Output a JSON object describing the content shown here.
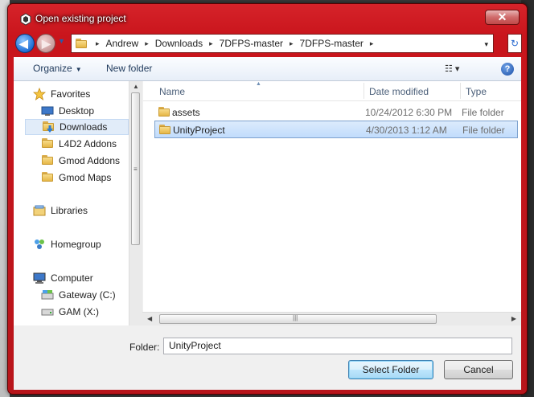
{
  "window": {
    "title": "Open existing project",
    "close_label": "✕"
  },
  "address": {
    "crumbs": [
      "Andrew",
      "Downloads",
      "7DFPS-master",
      "7DFPS-master"
    ],
    "separator": "▸",
    "dropdown_glyph": "▾",
    "refresh_glyph": "↻"
  },
  "toolbar": {
    "organize_label": "Organize",
    "new_folder_label": "New folder",
    "view_glyph": "☷ ▾",
    "help_glyph": "?"
  },
  "nav": {
    "items": [
      {
        "label": "Favorites",
        "icon": "star-icon"
      },
      {
        "label": "Desktop",
        "icon": "desktop-icon"
      },
      {
        "label": "Downloads",
        "icon": "downloads-icon",
        "selected": true
      },
      {
        "label": "L4D2 Addons",
        "icon": "folder-icon"
      },
      {
        "label": "Gmod Addons",
        "icon": "folder-icon"
      },
      {
        "label": "Gmod Maps",
        "icon": "folder-icon"
      },
      {
        "label": "Libraries",
        "icon": "libraries-icon"
      },
      {
        "label": "Homegroup",
        "icon": "homegroup-icon"
      },
      {
        "label": "Computer",
        "icon": "computer-icon"
      },
      {
        "label": "Gateway (C:)",
        "icon": "drive-icon"
      },
      {
        "label": "GAM (X:)",
        "icon": "drive-icon"
      }
    ]
  },
  "columns": {
    "name": "Name",
    "date": "Date modified",
    "type": "Type"
  },
  "files": [
    {
      "name": "assets",
      "date": "10/24/2012 6:30 PM",
      "type": "File folder"
    },
    {
      "name": "UnityProject",
      "date": "4/30/2013 1:12 AM",
      "type": "File folder",
      "selected": true
    }
  ],
  "footer": {
    "folder_label": "Folder:",
    "folder_value": "UnityProject",
    "select_label": "Select Folder",
    "cancel_label": "Cancel"
  },
  "colors": {
    "frame": "#c9151c",
    "selection": "#c1dcfc",
    "accent": "#3c7fb1"
  }
}
